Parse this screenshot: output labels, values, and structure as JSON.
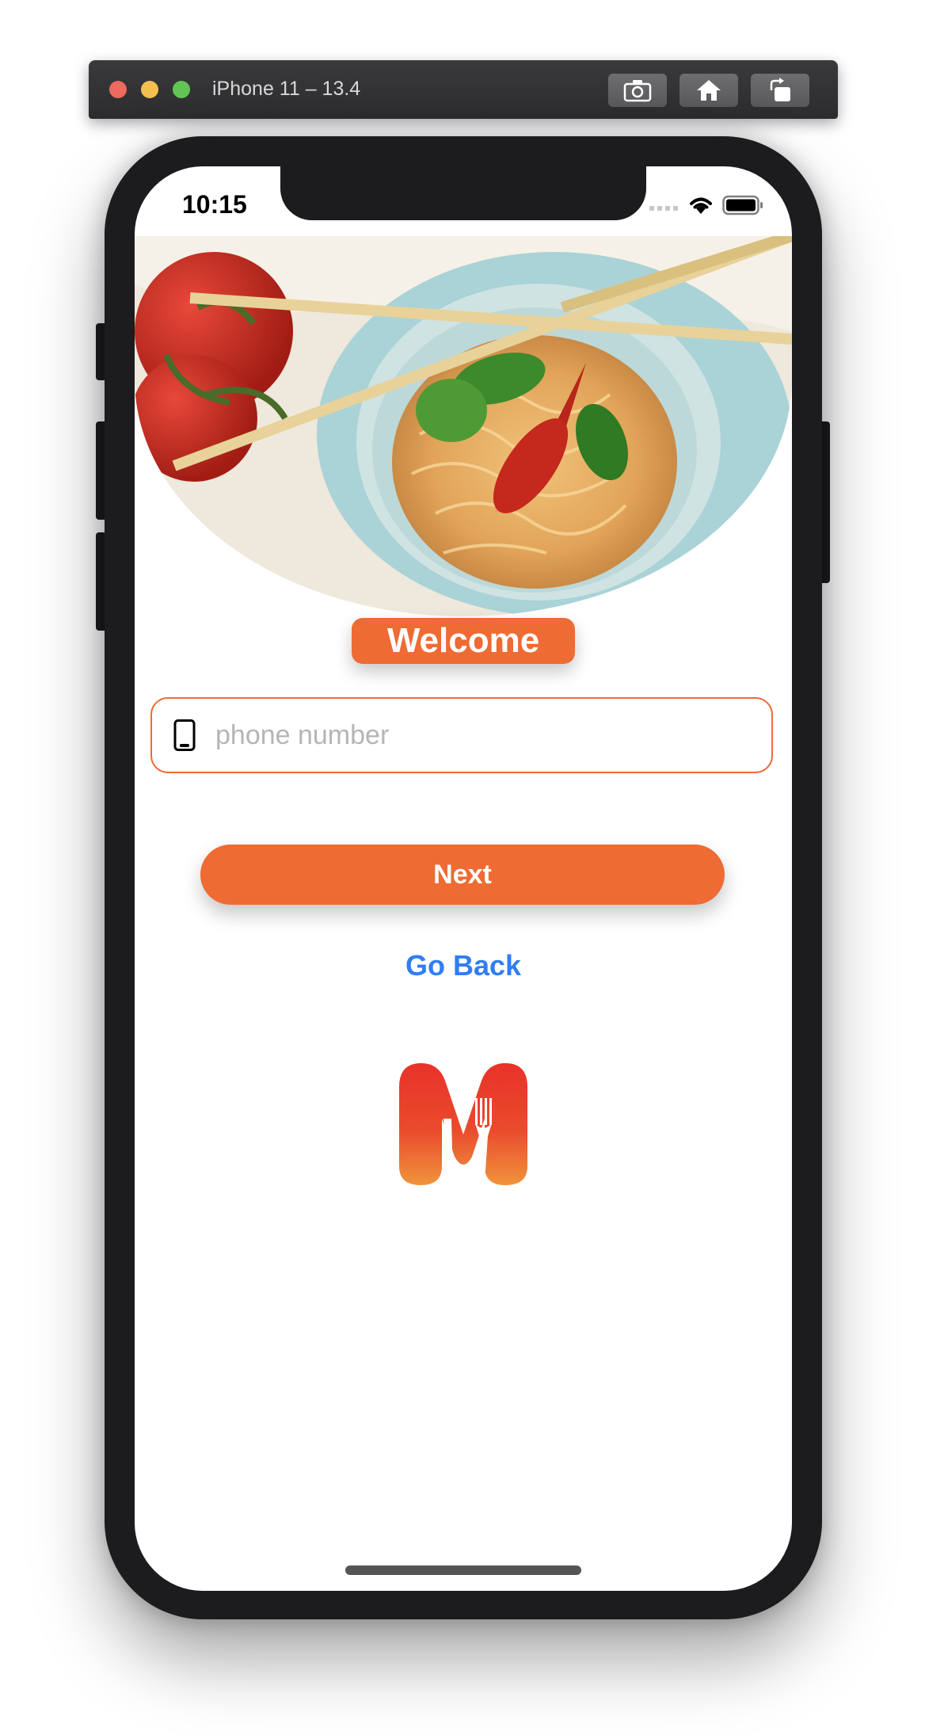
{
  "simulator": {
    "title": "iPhone 11 – 13.4",
    "buttons": [
      "screenshot-icon",
      "home-icon",
      "rotate-icon"
    ]
  },
  "status_bar": {
    "time": "10:15",
    "icons": [
      "signal-icon",
      "wifi-icon",
      "battery-icon"
    ]
  },
  "hero": {
    "image": "noodle-bowl-photo"
  },
  "welcome": {
    "label": "Welcome"
  },
  "phone_input": {
    "placeholder": "phone number",
    "value": "",
    "icon": "mobile-phone-icon"
  },
  "next_button": {
    "label": "Next"
  },
  "go_back": {
    "label": "Go Back"
  },
  "logo": {
    "name": "app-logo"
  },
  "colors": {
    "accent": "#ee6b34",
    "link": "#2f7ef5"
  }
}
